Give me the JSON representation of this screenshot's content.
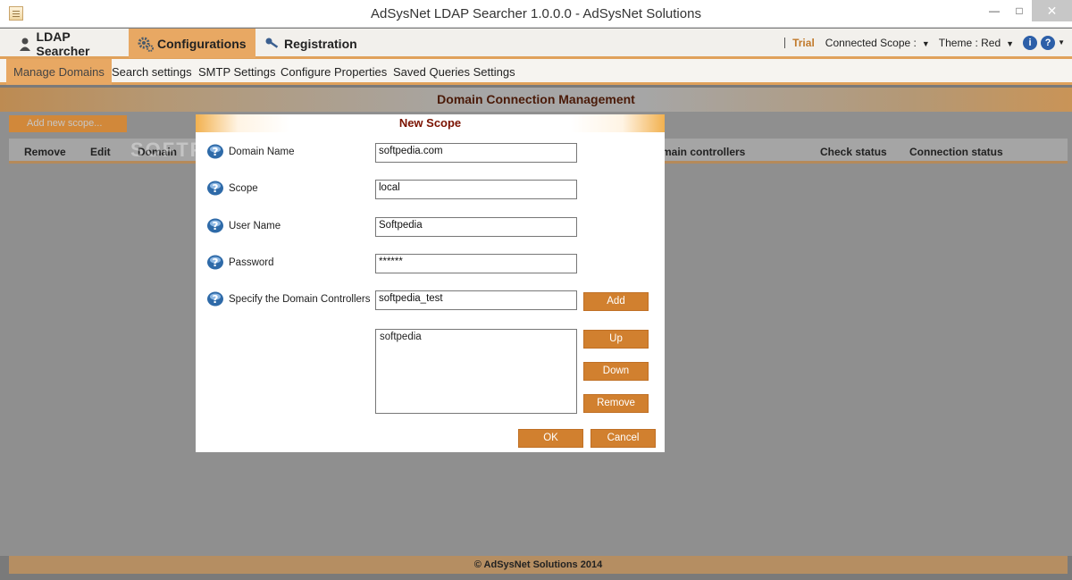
{
  "window": {
    "title": "AdSysNet LDAP Searcher 1.0.0.0 - AdSysNet Solutions",
    "controls": {
      "minimize": "—",
      "maximize": "□",
      "close": "✕"
    }
  },
  "menu": {
    "items": [
      {
        "label": "LDAP Searcher",
        "icon": "user-icon"
      },
      {
        "label": "Configurations",
        "icon": "gears-icon"
      },
      {
        "label": "Registration",
        "icon": "key-icon"
      }
    ],
    "trial": "Trial",
    "connected_scope": "Connected Scope :",
    "theme": "Theme : Red"
  },
  "submenu": {
    "items": [
      "Manage Domains",
      "Search settings",
      "SMTP Settings",
      "Configure Properties",
      "Saved Queries Settings"
    ],
    "active": "Manage Domains"
  },
  "main": {
    "section_title": "Domain Connection Management",
    "add_scope_label": "Add new scope...",
    "columns": [
      "Remove",
      "Edit",
      "Domain",
      "main controllers",
      "Check status",
      "Connection status"
    ],
    "watermark": "SOFTPEDIA"
  },
  "dialog": {
    "title": "New Scope",
    "fields": [
      {
        "label": "Domain Name",
        "value": "softpedia.com"
      },
      {
        "label": "Scope",
        "value": "local"
      },
      {
        "label": "User Name",
        "value": "Softpedia"
      },
      {
        "label": "Password",
        "value": "******"
      },
      {
        "label": "Specify the Domain Controllers",
        "value": "softpedia_test"
      }
    ],
    "controllers_list": [
      "softpedia"
    ],
    "buttons": {
      "add": "Add",
      "up": "Up",
      "down": "Down",
      "remove": "Remove",
      "ok": "OK",
      "cancel": "Cancel"
    }
  },
  "footer": {
    "text": "© AdSysNet Solutions 2014"
  },
  "colors": {
    "accent": "#d1802f",
    "header_text": "#7a1200"
  }
}
